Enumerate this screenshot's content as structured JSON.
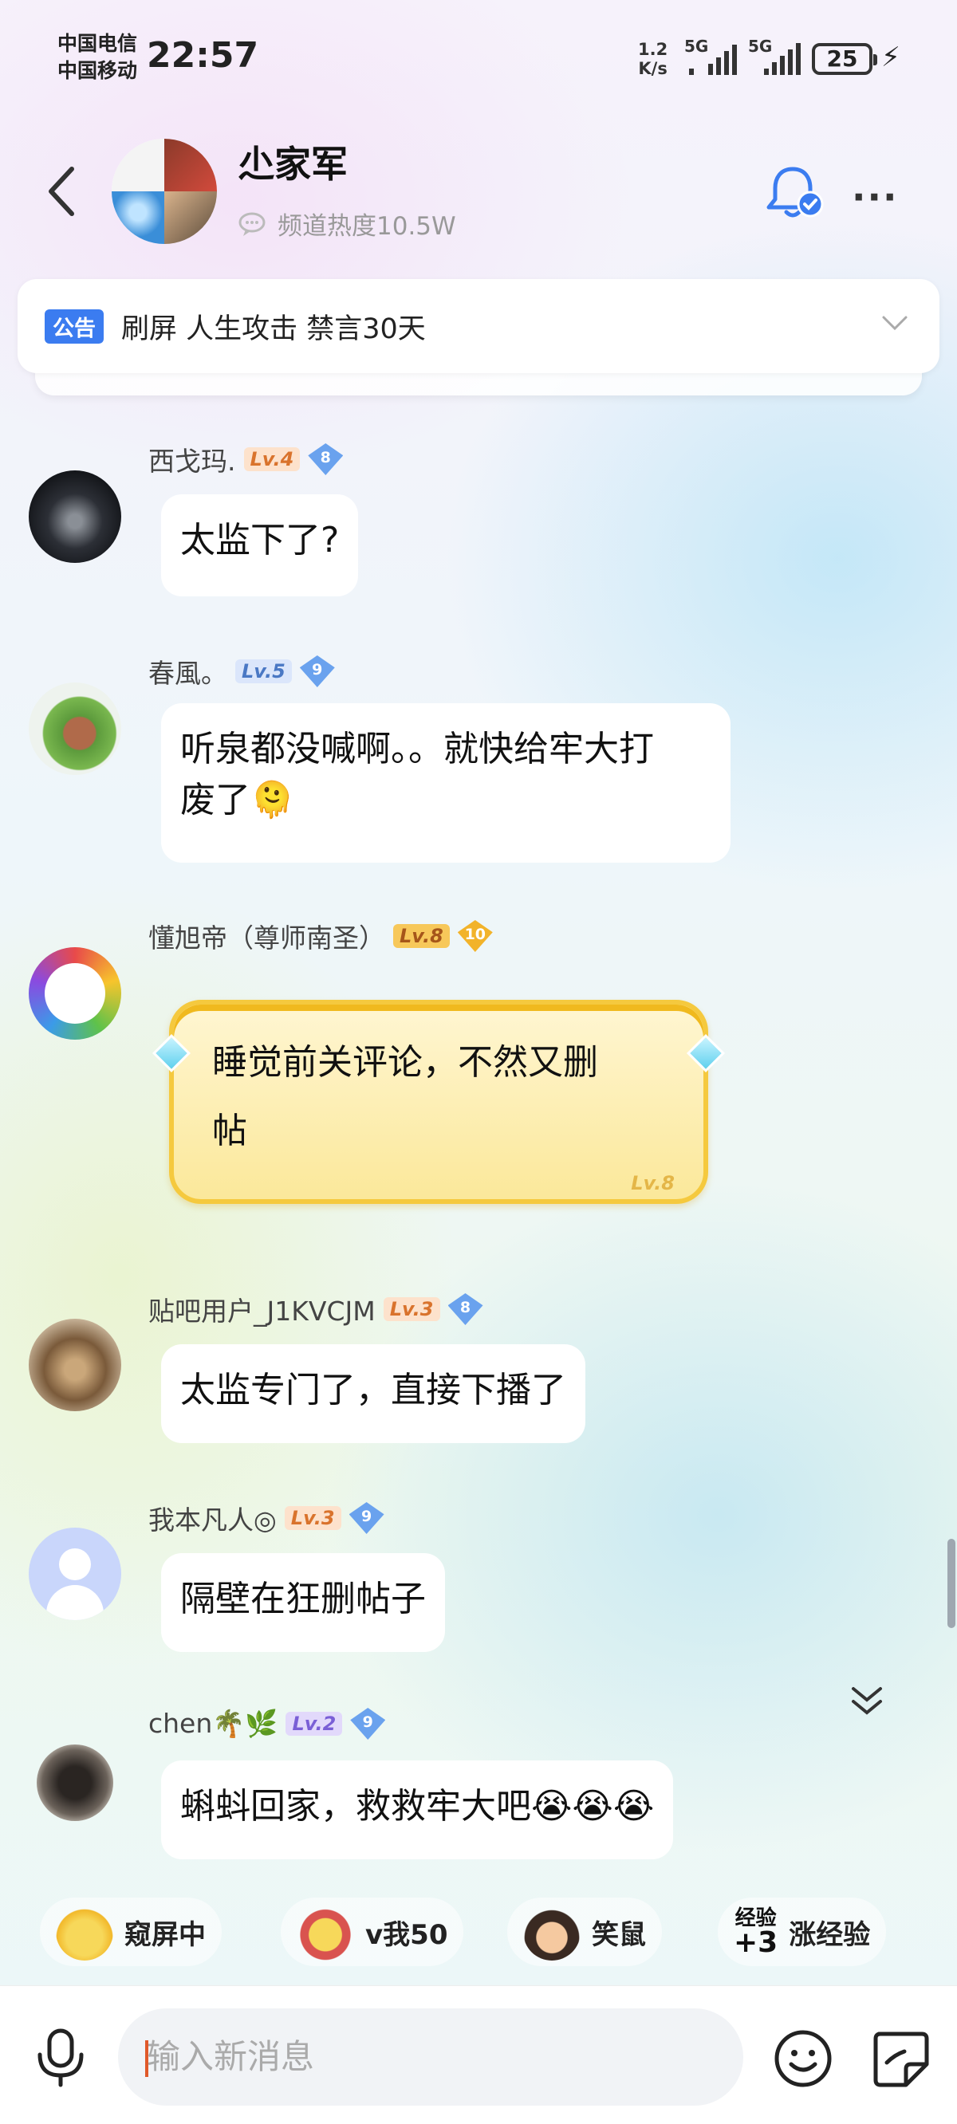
{
  "status_bar": {
    "carrier_1": "中国电信",
    "carrier_2": "中国移动",
    "time": "22:57",
    "net_speed_value": "1.2",
    "net_speed_unit": "K/s",
    "sim1_gen": "5G",
    "sim2_gen": "5G",
    "battery": "25"
  },
  "header": {
    "title": "尐家军",
    "heat": "频道热度10.5W"
  },
  "notice": {
    "tag": "公告",
    "text": "刷屏 人生攻击 禁言30天"
  },
  "messages": [
    {
      "name": "西戈玛.",
      "level": "Lv.4",
      "badge": "8",
      "text": "太监下了?"
    },
    {
      "name": "春風。",
      "level": "Lv.5",
      "badge": "9",
      "text": "听泉都没喊啊。。就快给牢大打",
      "text2": "废了🫠"
    },
    {
      "name": "懂旭帝（尊师南圣）",
      "level": "Lv.8",
      "badge": "10",
      "text": "睡觉前关评论，不然又删",
      "text2": "帖",
      "bubble_level": "Lv.8"
    },
    {
      "name": "贴吧用户_J1KVCJM",
      "level": "Lv.3",
      "badge": "8",
      "text": "太监专门了，直接下播了"
    },
    {
      "name": "我本凡人◎",
      "level": "Lv.3",
      "badge": "9",
      "text": "隔壁在狂删帖子"
    },
    {
      "name": "chen🌴🌿",
      "level": "Lv.2",
      "badge": "9",
      "text": "蝌蚪回家，救救牢大吧😭😭😭"
    }
  ],
  "quick_replies": {
    "item1": "窥屏中",
    "item2": "v我50",
    "item3": "笑鼠",
    "item4_icon_top": "经验",
    "item4_icon_bottom": "+3",
    "item4": "涨经验"
  },
  "input": {
    "placeholder": "输入新消息"
  },
  "colors": {
    "notice_tag": "#3b7cf0",
    "level_orange": "#fde2cc",
    "level_gold": "#f7c85a",
    "gem_blue": "#6aa2ee",
    "gold_bubble": "#fbe89a"
  }
}
